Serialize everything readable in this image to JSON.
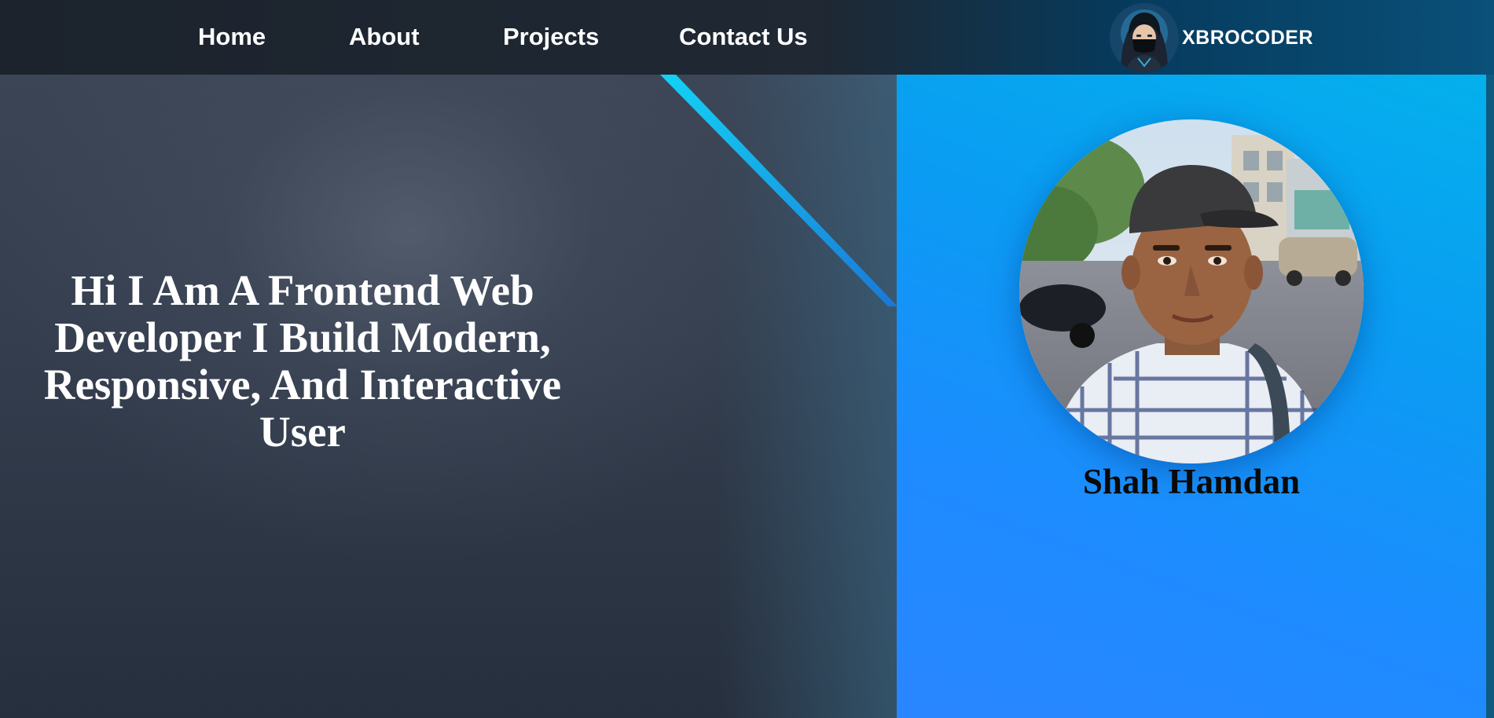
{
  "nav": {
    "links": [
      {
        "label": "Home"
      },
      {
        "label": "About"
      },
      {
        "label": "Projects"
      },
      {
        "label": "Contact Us"
      }
    ],
    "brand": {
      "name": "XBROCODER",
      "avatar_icon": "masked-coder-avatar"
    }
  },
  "hero": {
    "headline": "Hi I Am A Frontend Web Developer I Build Modern, Responsive, And Interactive User"
  },
  "profile": {
    "name": "Shah Hamdan",
    "photo_icon": "profile-photo"
  },
  "colors": {
    "navbar_dark": "#1c232d",
    "navbar_accent": "#0a5079",
    "hero_dark": "#343e4e",
    "profile_panel": "#0a9cf3",
    "streak": "#12c4f0",
    "name_text": "#0a0a0a"
  }
}
